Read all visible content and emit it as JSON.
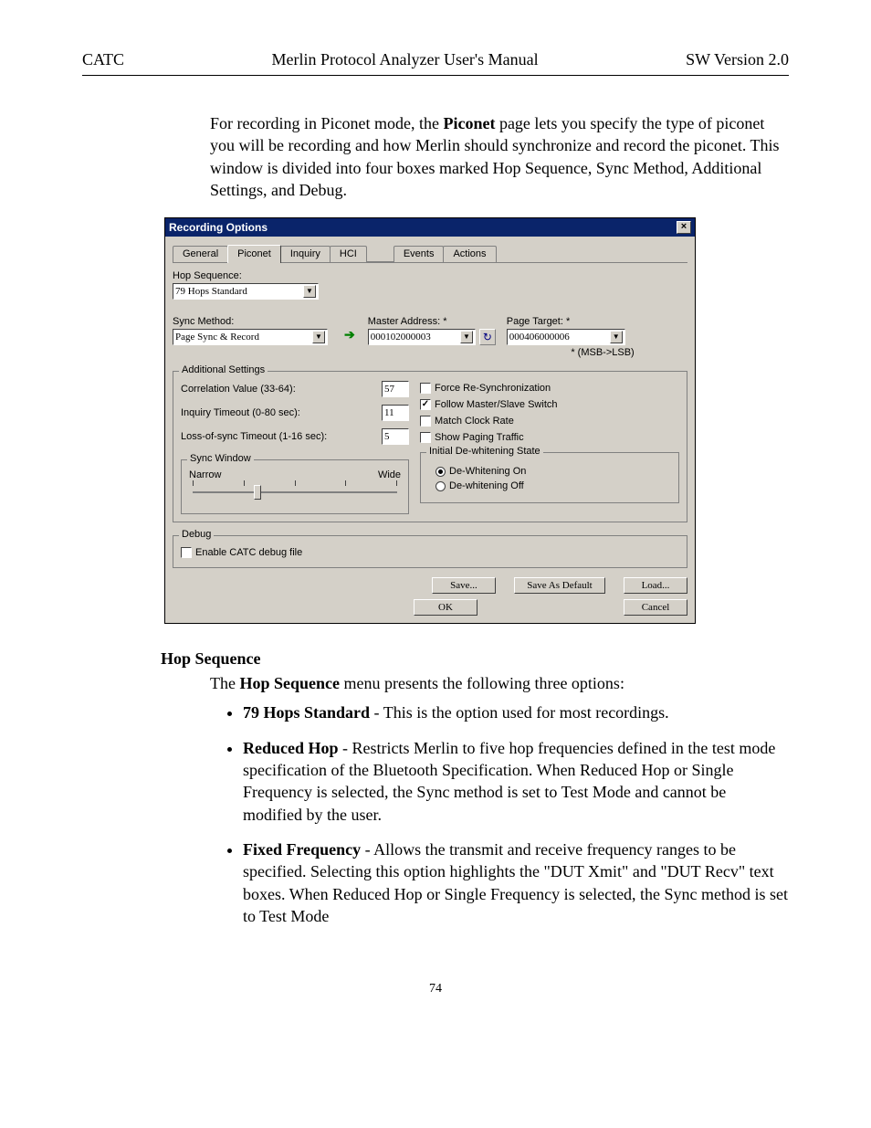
{
  "header": {
    "left": "CATC",
    "center": "Merlin Protocol Analyzer User's Manual",
    "right": "SW Version 2.0"
  },
  "intro": {
    "p": "For recording in Piconet mode, the ",
    "bold1": "Piconet",
    "p2": " page lets you specify the type of piconet you will be recording and how Merlin should synchronize and record the piconet.  This window is divided into four boxes marked Hop Sequence, Sync Method,  Additional Settings, and Debug."
  },
  "dialog": {
    "title": "Recording Options",
    "tabs": [
      "General",
      "Piconet",
      "Inquiry",
      "HCI",
      "Events",
      "Actions"
    ],
    "selectedTab": 1,
    "hopSeq": {
      "label": "Hop Sequence:",
      "value": "79 Hops Standard"
    },
    "syncMethod": {
      "label": "Sync Method:",
      "value": "Page Sync & Record"
    },
    "masterAddr": {
      "label": "Master Address: *",
      "value": "000102000003"
    },
    "pageTarget": {
      "label": "Page Target: *",
      "value": "000406000006"
    },
    "msb": "* (MSB->LSB)",
    "addSettings": {
      "legend": "Additional Settings",
      "corr": {
        "label": "Correlation Value (33-64):",
        "value": "57"
      },
      "inq": {
        "label": "Inquiry Timeout (0-80 sec):",
        "value": "11"
      },
      "loss": {
        "label": "Loss-of-sync Timeout (1-16 sec):",
        "value": "5"
      },
      "chk1": "Force Re-Synchronization",
      "chk2": "Follow Master/Slave Switch",
      "chk3": "Match Clock Rate",
      "chk4": "Show Paging Traffic",
      "syncWin": {
        "legend": "Sync Window",
        "left": "Narrow",
        "right": "Wide"
      },
      "dewh": {
        "legend": "Initial De-whitening State",
        "on": "De-Whitening On",
        "off": "De-whitening Off"
      }
    },
    "debug": {
      "legend": "Debug",
      "chk": "Enable CATC debug file"
    },
    "buttons": {
      "save": "Save...",
      "saveDef": "Save As Default",
      "load": "Load...",
      "ok": "OK",
      "cancel": "Cancel"
    }
  },
  "section": {
    "head": "Hop Sequence",
    "lead": "The ",
    "bold": "Hop Sequence",
    "lead2": "  menu presents the following three options:",
    "items": [
      {
        "b": "79 Hops Standard",
        "t": "  - This is the option used for most recordings."
      },
      {
        "b": "Reduced Hop",
        "t": " - Restricts Merlin to five hop frequencies defined in the test mode specification of the Bluetooth Specification.  When Reduced Hop or Single Frequency is selected, the Sync method is set to Test Mode and cannot be modified by the user."
      },
      {
        "b": "Fixed Frequency",
        "t": " - Allows the transmit and receive frequency ranges to be specified.  Selecting this option highlights the \"DUT Xmit\" and \"DUT Recv\" text boxes.  When Reduced Hop or Single Frequency is selected, the Sync method is set to Test Mode"
      }
    ]
  },
  "pageNum": "74"
}
